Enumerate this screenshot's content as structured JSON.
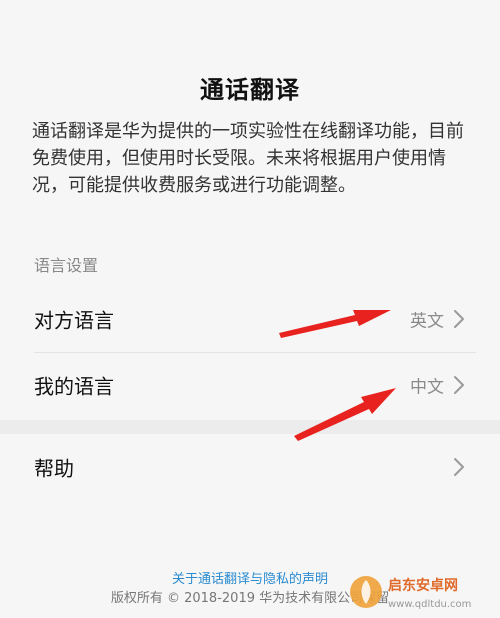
{
  "header": {
    "title": "通话翻译"
  },
  "description": "通话翻译是华为提供的一项实验性在线翻译功能，目前免费使用，但使用时长受限。未来将根据用户使用情况，可能提供收费服务或进行功能调整。",
  "language_settings": {
    "section_label": "语言设置",
    "items": [
      {
        "label": "对方语言",
        "value": "英文"
      },
      {
        "label": "我的语言",
        "value": "中文"
      }
    ]
  },
  "help": {
    "label": "帮助"
  },
  "footer": {
    "privacy_link": "关于通话翻译与隐私的声明",
    "copyright": "版权所有 © 2018-2019 华为技术有限公司保留"
  },
  "watermark": {
    "brand": "启东安卓网",
    "url": "www.qdltdu.com"
  },
  "colors": {
    "background": "#f6f6f6",
    "link": "#2a8bd1",
    "annotation_arrow": "#e8231f",
    "secondary_text": "#8a8a8a"
  }
}
